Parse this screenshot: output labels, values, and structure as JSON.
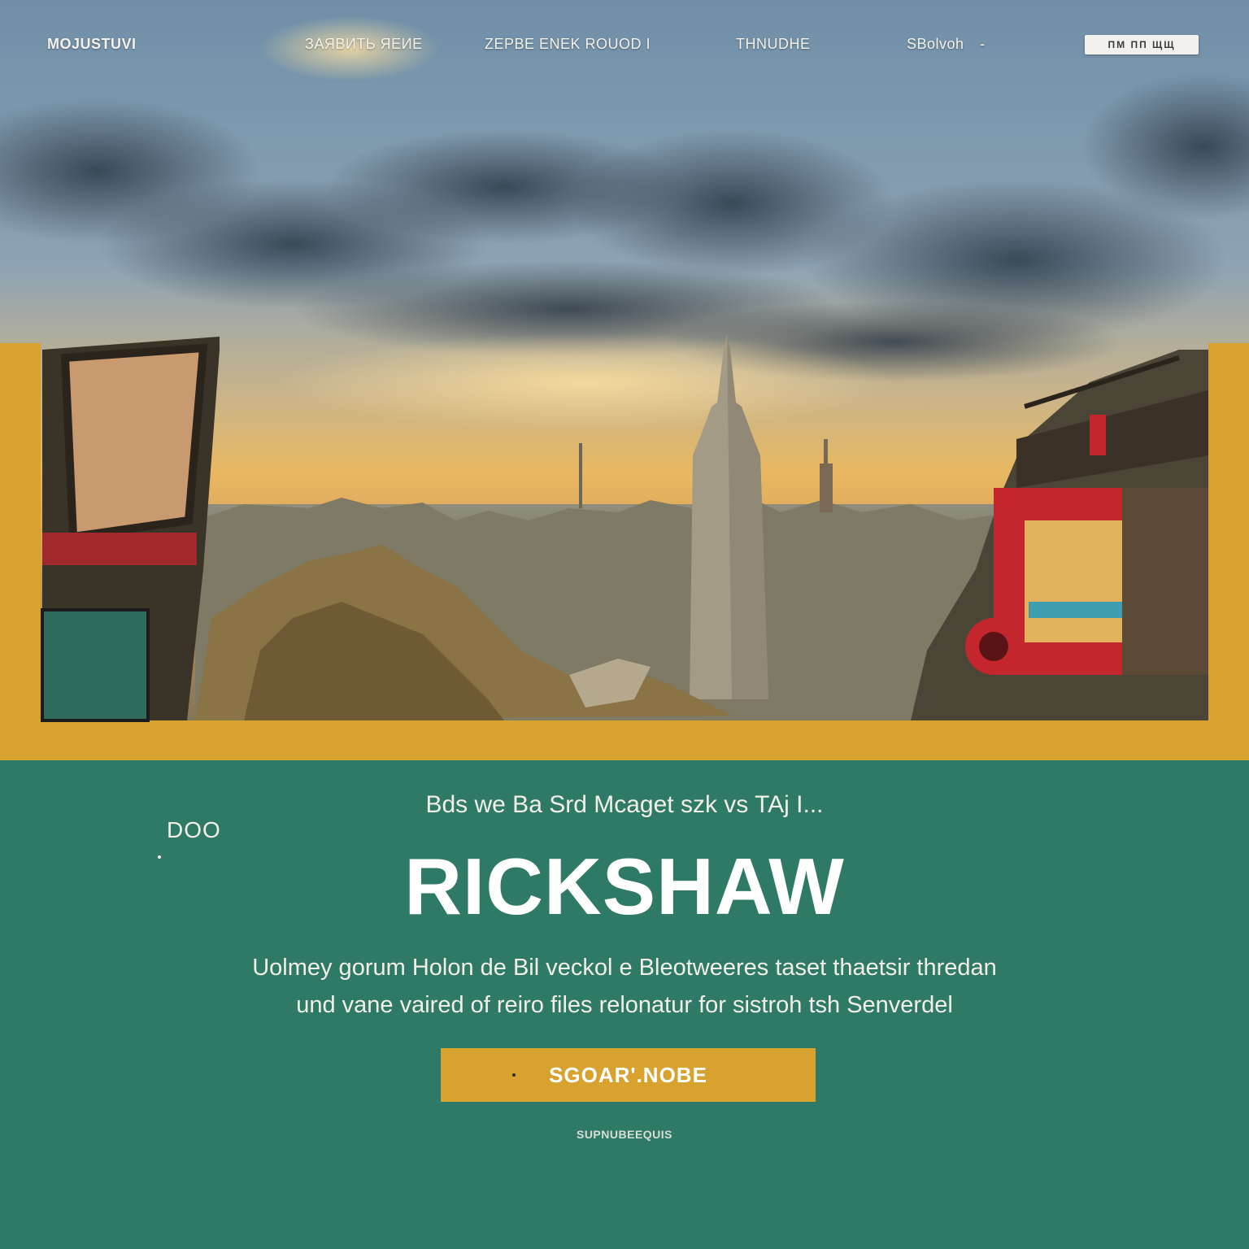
{
  "nav": {
    "brand": "MOJUSTUVI",
    "items": [
      {
        "label": "ЗАЯВИТЬ ЯЕИE"
      },
      {
        "label": "ZEPBE ENEK ROUOD I"
      },
      {
        "label": "THNUDHЕ"
      },
      {
        "label": "SBolvoh"
      }
    ],
    "pill_label": "ПМ  ПП  ЩЩ"
  },
  "main": {
    "eyebrow": "Bds we Ba Srd Mcaget szk vs TAj I...",
    "side_mark": "DOO",
    "headline": "RICKSHAW",
    "body_line_1": "Uolmey gorum Holon de Bil veckol e Bleotweeres taset thaetsir thredan",
    "body_line_2": "und vane vaired of reiro files relonatur for sistroh tsh Senverdel",
    "cta_label": "SGOAR'.NOBE",
    "footer_note": "SUPNUBEEQUIS"
  },
  "colors": {
    "mustard": "#d8a22e",
    "green": "#2f7a66",
    "white": "#ffffff"
  },
  "icons": {
    "nav_dropdown": "chevron-down-icon"
  }
}
